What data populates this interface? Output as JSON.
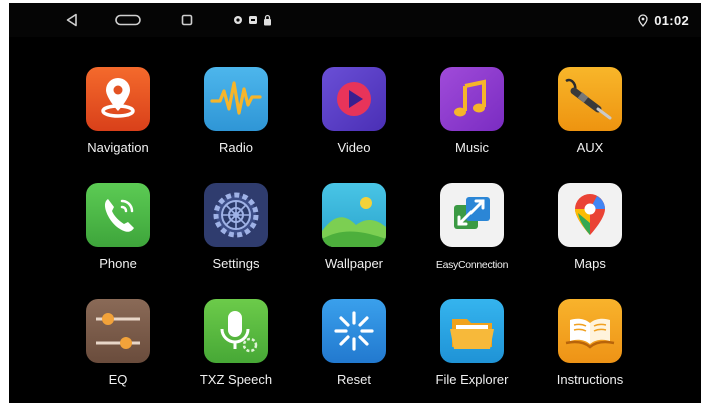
{
  "status_bar": {
    "time": "01:02",
    "location_icon": "location-pin-icon",
    "nav_buttons": [
      "back-icon",
      "home-icon",
      "recents-icon"
    ],
    "notification_icons": [
      "record-icon",
      "media-icon",
      "lock-icon"
    ]
  },
  "apps": [
    {
      "label": "Navigation",
      "icon": "navigation-pin-icon",
      "color": "#e8521f"
    },
    {
      "label": "Radio",
      "icon": "radio-wave-icon",
      "color": "#3ea7e3"
    },
    {
      "label": "Video",
      "icon": "video-play-icon",
      "color": "#5a3fc7"
    },
    {
      "label": "Music",
      "icon": "music-note-icon",
      "color": "#8e3bd0"
    },
    {
      "label": "AUX",
      "icon": "aux-cable-icon",
      "color": "#f3a417"
    },
    {
      "label": "Phone",
      "icon": "phone-icon",
      "color": "#4bb84a"
    },
    {
      "label": "Settings",
      "icon": "settings-gear-icon",
      "color": "#2f3c6e"
    },
    {
      "label": "Wallpaper",
      "icon": "wallpaper-icon",
      "color": "#33b6d9"
    },
    {
      "label": "EasyConnection",
      "icon": "easyconnection-icon",
      "color": "#f4f4f4"
    },
    {
      "label": "Maps",
      "icon": "maps-pin-icon",
      "color": "#f4f4f4"
    },
    {
      "label": "EQ",
      "icon": "eq-sliders-icon",
      "color": "#7a5b4a"
    },
    {
      "label": "TXZ Speech",
      "icon": "microphone-icon",
      "color": "#5cbf3e"
    },
    {
      "label": "Reset",
      "icon": "reset-icon",
      "color": "#2b8ee0"
    },
    {
      "label": "File Explorer",
      "icon": "folder-icon",
      "color": "#28a8e6"
    },
    {
      "label": "Instructions",
      "icon": "book-icon",
      "color": "#f3a21b"
    }
  ]
}
